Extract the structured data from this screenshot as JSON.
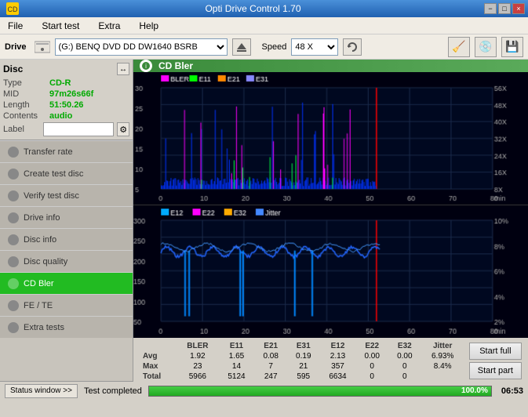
{
  "titlebar": {
    "title": "Opti Drive Control 1.70",
    "min_label": "−",
    "max_label": "□",
    "close_label": "×"
  },
  "menubar": {
    "items": [
      "File",
      "Start test",
      "Extra",
      "Help"
    ]
  },
  "drivebar": {
    "drive_label": "Drive",
    "drive_value": "(G:)  BENQ DVD DD DW1640 BSRB",
    "speed_label": "Speed",
    "speed_value": "48 X"
  },
  "disc": {
    "title": "Disc",
    "type_label": "Type",
    "type_value": "CD-R",
    "mid_label": "MID",
    "mid_value": "97m26s66f",
    "length_label": "Length",
    "length_value": "51:50.26",
    "contents_label": "Contents",
    "contents_value": "audio",
    "label_label": "Label",
    "label_value": ""
  },
  "sidebar": {
    "items": [
      {
        "id": "transfer-rate",
        "label": "Transfer rate",
        "active": false
      },
      {
        "id": "create-test-disc",
        "label": "Create test disc",
        "active": false
      },
      {
        "id": "verify-test-disc",
        "label": "Verify test disc",
        "active": false
      },
      {
        "id": "drive-info",
        "label": "Drive info",
        "active": false
      },
      {
        "id": "disc-info",
        "label": "Disc info",
        "active": false
      },
      {
        "id": "disc-quality",
        "label": "Disc quality",
        "active": false
      },
      {
        "id": "cd-bler",
        "label": "CD Bler",
        "active": true
      },
      {
        "id": "fe-te",
        "label": "FE / TE",
        "active": false
      },
      {
        "id": "extra-tests",
        "label": "Extra tests",
        "active": false
      }
    ]
  },
  "chart": {
    "title": "CD Bler",
    "legend1": [
      "BLER",
      "E11",
      "E21",
      "E31"
    ],
    "legend2": [
      "E12",
      "E22",
      "E32",
      "Jitter"
    ]
  },
  "stats": {
    "headers": [
      "BLER",
      "E11",
      "E21",
      "E31",
      "E12",
      "E22",
      "E32",
      "Jitter"
    ],
    "rows": [
      {
        "label": "Avg",
        "values": [
          "1.92",
          "1.65",
          "0.08",
          "0.19",
          "2.13",
          "0.00",
          "0.00",
          "6.93%"
        ]
      },
      {
        "label": "Max",
        "values": [
          "23",
          "14",
          "7",
          "21",
          "357",
          "0",
          "0",
          "8.4%"
        ]
      },
      {
        "label": "Total",
        "values": [
          "5966",
          "5124",
          "247",
          "595",
          "6634",
          "0",
          "0",
          ""
        ]
      }
    ],
    "btn_full": "Start full",
    "btn_part": "Start part"
  },
  "statusbar": {
    "window_btn": "Status window >>",
    "status_text": "Test completed",
    "progress": 100,
    "progress_text": "100.0%",
    "time": "06:53"
  }
}
